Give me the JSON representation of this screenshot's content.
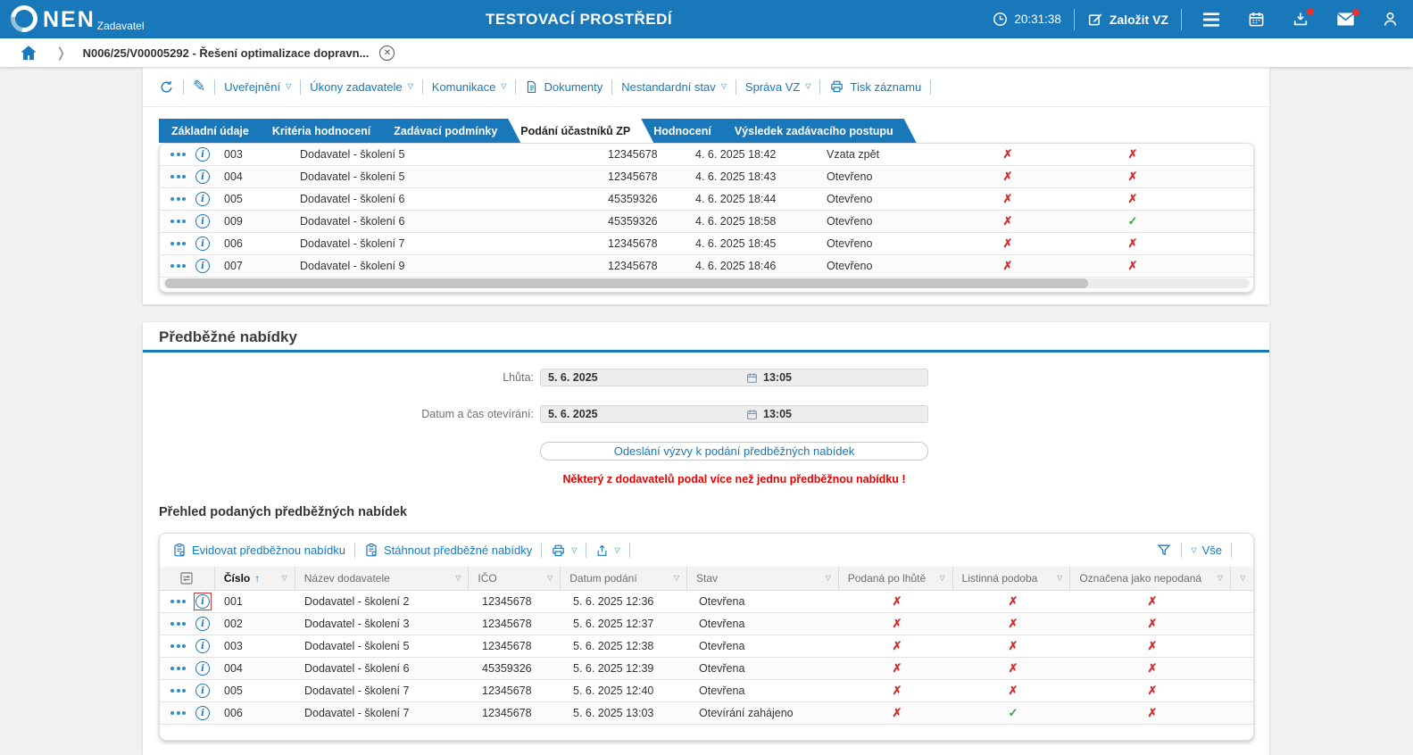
{
  "colors": {
    "accent": "#1878ba",
    "mark_red": "#d22d2d",
    "mark_green": "#3aa73a",
    "warning_red": "#e80000"
  },
  "topbar": {
    "brand": "NEN",
    "brand_sub": "Zadavatel",
    "title": "TESTOVACÍ PROSTŘEDÍ",
    "time": "20:31:38",
    "create_vz_label": "Založit VZ"
  },
  "breadcrumb": {
    "record": "N006/25/V00005292 - Řešení optimalizace dopravn..."
  },
  "record_toolbar": {
    "items": [
      {
        "label": "Uveřejnění",
        "dropdown": true
      },
      {
        "label": "Úkony zadavatele",
        "dropdown": true
      },
      {
        "label": "Komunikace",
        "dropdown": true
      },
      {
        "label": "Dokumenty",
        "icon": "document"
      },
      {
        "label": "Nestandardní stav",
        "dropdown": true
      },
      {
        "label": "Správa VZ",
        "dropdown": true
      },
      {
        "label": "Tisk záznamu",
        "icon": "printer"
      }
    ]
  },
  "tabs": {
    "items": [
      "Základní údaje",
      "Kritéria hodnocení",
      "Zadávací podmínky",
      "Podání účastníků ZP",
      "Hodnocení",
      "Výsledek zadávacího postupu"
    ],
    "active": "Podání účastníků ZP"
  },
  "participants_table": {
    "rows": [
      {
        "num": "003",
        "supplier": "Dodavatel - školení 5",
        "ico": "12345678",
        "submitted": "4. 6. 2025 18:42",
        "status": "Vzata zpět",
        "marks": [
          "✗",
          "✗"
        ]
      },
      {
        "num": "004",
        "supplier": "Dodavatel - školení 5",
        "ico": "12345678",
        "submitted": "4. 6. 2025 18:43",
        "status": "Otevřeno",
        "marks": [
          "✗",
          "✗"
        ]
      },
      {
        "num": "005",
        "supplier": "Dodavatel - školení 6",
        "ico": "45359326",
        "submitted": "4. 6. 2025 18:44",
        "status": "Otevřeno",
        "marks": [
          "✗",
          "✗"
        ]
      },
      {
        "num": "009",
        "supplier": "Dodavatel - školení 6",
        "ico": "45359326",
        "submitted": "4. 6. 2025 18:58",
        "status": "Otevřeno",
        "marks": [
          "✗",
          "✓"
        ]
      },
      {
        "num": "006",
        "supplier": "Dodavatel - školení 7",
        "ico": "12345678",
        "submitted": "4. 6. 2025 18:45",
        "status": "Otevřeno",
        "marks": [
          "✗",
          "✗"
        ]
      },
      {
        "num": "007",
        "supplier": "Dodavatel - školení 9",
        "ico": "12345678",
        "submitted": "4. 6. 2025 18:46",
        "status": "Otevřeno",
        "marks": [
          "✗",
          "✗"
        ]
      }
    ]
  },
  "prelim": {
    "heading": "Předběžné nabídky",
    "fields": [
      {
        "label": "Lhůta:",
        "date": "5. 6. 2025",
        "time": "13:05"
      },
      {
        "label": "Datum a čas otevírání:",
        "date": "5. 6. 2025",
        "time": "13:05"
      }
    ],
    "send_button": "Odeslání výzvy k podání předběžných nabídek",
    "warning": "Některý z dodavatelů podal více než jednu předběžnou nabídku !"
  },
  "overview": {
    "heading": "Přehled podaných předběžných nabídek",
    "toolbar": {
      "evidovat": "Evidovat předběžnou nabídku",
      "stahnout": "Stáhnout předběžné nabídky",
      "vse": "Vše"
    },
    "headers": [
      "Číslo",
      "Název dodavatele",
      "IČO",
      "Datum podání",
      "Stav",
      "Podaná po lhůtě",
      "Listinná podoba",
      "Označena jako nepodaná"
    ],
    "sorted_by": "Číslo",
    "rows": [
      {
        "num": "001",
        "supplier": "Dodavatel - školení 2",
        "ico": "12345678",
        "submitted": "5. 6. 2025 12:36",
        "status": "Otevřena",
        "marks": [
          "✗",
          "✗",
          "✗"
        ],
        "info_flagged": true
      },
      {
        "num": "002",
        "supplier": "Dodavatel - školení 3",
        "ico": "12345678",
        "submitted": "5. 6. 2025 12:37",
        "status": "Otevřena",
        "marks": [
          "✗",
          "✗",
          "✗"
        ],
        "info_flagged": false
      },
      {
        "num": "003",
        "supplier": "Dodavatel - školení 5",
        "ico": "12345678",
        "submitted": "5. 6. 2025 12:38",
        "status": "Otevřena",
        "marks": [
          "✗",
          "✗",
          "✗"
        ],
        "info_flagged": false
      },
      {
        "num": "004",
        "supplier": "Dodavatel - školení 6",
        "ico": "45359326",
        "submitted": "5. 6. 2025 12:39",
        "status": "Otevřena",
        "marks": [
          "✗",
          "✗",
          "✗"
        ],
        "info_flagged": false
      },
      {
        "num": "005",
        "supplier": "Dodavatel - školení 7",
        "ico": "12345678",
        "submitted": "5. 6. 2025 12:40",
        "status": "Otevřena",
        "marks": [
          "✗",
          "✗",
          "✗"
        ],
        "info_flagged": false
      },
      {
        "num": "006",
        "supplier": "Dodavatel - školení 7",
        "ico": "12345678",
        "submitted": "5. 6. 2025 13:03",
        "status": "Otevírání zahájeno",
        "marks": [
          "✗",
          "✓",
          "✗"
        ],
        "info_flagged": false
      }
    ]
  }
}
